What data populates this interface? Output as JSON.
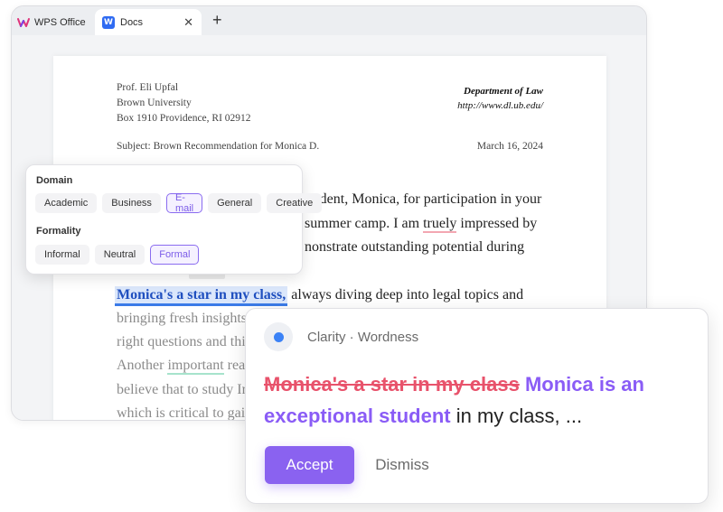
{
  "tabs": [
    {
      "label": "WPS Office",
      "icon": "wps-logo-icon"
    },
    {
      "label": "Docs",
      "icon": "docs-logo-icon",
      "icon_letter": "W",
      "close": "✕"
    }
  ],
  "new_tab": "+",
  "letter": {
    "sender": [
      "Prof. Eli Upfal",
      "Brown University",
      "Box 1910 Providence, RI 02912"
    ],
    "department": "Department of Law",
    "website": "http://www.dl.ub.edu/",
    "subject": "Subject: Brown Recommendation for Monica D.",
    "date": "March 16, 2024",
    "lines": {
      "l1": "student, Monica, for participation in your",
      "l2a": "summer camp. I am ",
      "l2b": "truely",
      "l2c": " impressed by",
      "l3": "nonstrate outstanding potential during",
      "l4_highlight": "Monica's a star in my class,",
      "l4_rest": " always diving deep into legal topics and",
      "l5": "bringing fresh insights",
      "l6": "right questions and thi",
      "l7a": "Another ",
      "l7b": "important",
      "l7c": " rea",
      "l8": "believe that to study In",
      "l9": "which is critical to gai"
    }
  },
  "style_panel": {
    "domain_heading": "Domain",
    "domain_options": [
      "Academic",
      "Business",
      "E-mail",
      "General",
      "Creative"
    ],
    "domain_selected": "E-mail",
    "formality_heading": "Formality",
    "formality_options": [
      "Informal",
      "Neutral",
      "Formal"
    ],
    "formality_selected": "Formal"
  },
  "suggestion": {
    "category": "Clarity · Wordness",
    "original": "Monica's a star in my class",
    "replacement": "Monica is an exceptional student",
    "rest": " in my class, ...",
    "accept_label": "Accept",
    "dismiss_label": "Dismiss"
  },
  "colors": {
    "accent_purple": "#8a62f0",
    "strike_red": "#e8526b",
    "highlight_blue": "#3b7be8",
    "dot_blue": "#3b82f6"
  }
}
